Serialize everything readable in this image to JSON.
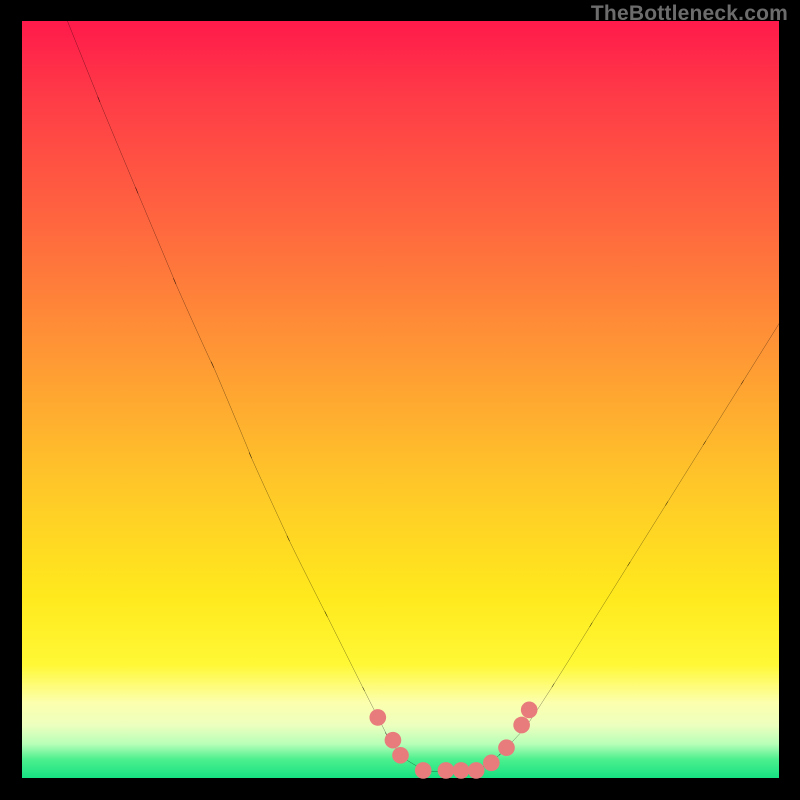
{
  "watermark": "TheBottleneck.com",
  "chart_data": {
    "type": "line",
    "title": "",
    "xlabel": "",
    "ylabel": "",
    "xlim": [
      0,
      100
    ],
    "ylim": [
      0,
      100
    ],
    "grid": false,
    "series": [
      {
        "name": "bottleneck-curve",
        "x": [
          6,
          10,
          15,
          20,
          25,
          30,
          35,
          40,
          45,
          48,
          50,
          53,
          56,
          60,
          63,
          66,
          70,
          75,
          80,
          85,
          90,
          95,
          100
        ],
        "y": [
          100,
          90,
          78,
          66,
          55,
          43,
          32,
          22,
          12,
          6,
          3,
          1,
          1,
          1,
          3,
          6,
          12,
          20,
          28,
          36,
          44,
          52,
          60
        ]
      }
    ],
    "markers": {
      "name": "highlight-points",
      "color": "#e87c7c",
      "points": [
        {
          "x": 47,
          "y": 8
        },
        {
          "x": 49,
          "y": 5
        },
        {
          "x": 50,
          "y": 3
        },
        {
          "x": 53,
          "y": 1
        },
        {
          "x": 56,
          "y": 1
        },
        {
          "x": 58,
          "y": 1
        },
        {
          "x": 60,
          "y": 1
        },
        {
          "x": 62,
          "y": 2
        },
        {
          "x": 64,
          "y": 4
        },
        {
          "x": 66,
          "y": 7
        },
        {
          "x": 67,
          "y": 9
        }
      ]
    },
    "gradient_stops": [
      {
        "pos": 0,
        "color": "#ff1a4b"
      },
      {
        "pos": 0.45,
        "color": "#ff9a34"
      },
      {
        "pos": 0.8,
        "color": "#fff835"
      },
      {
        "pos": 0.95,
        "color": "#b8ffb8"
      },
      {
        "pos": 1.0,
        "color": "#15e182"
      }
    ]
  }
}
